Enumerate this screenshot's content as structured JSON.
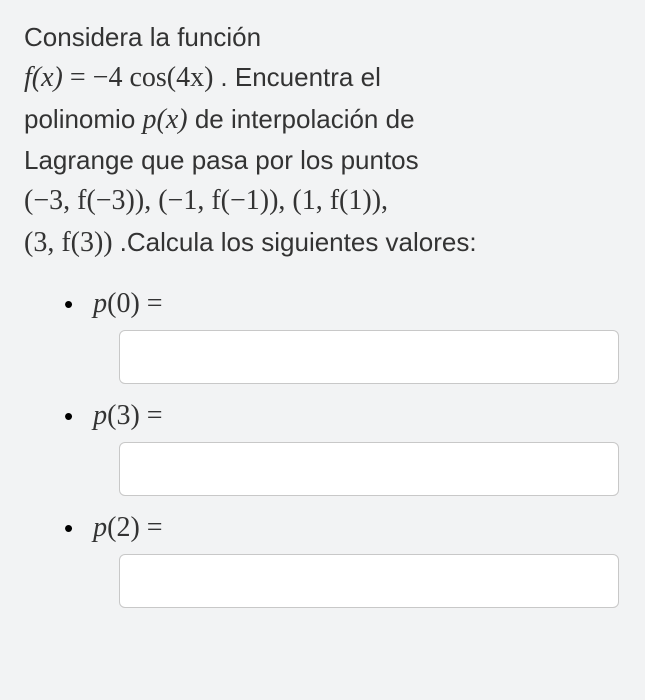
{
  "problem": {
    "intro": "Considera la función",
    "func_def_lhs": "f(x)",
    "func_def_eq": "=",
    "func_def_rhs": "−4 cos(4x)",
    "after_func": ". Encuentra el",
    "line2_pre": "polinomio ",
    "poly": "p(x)",
    "line2_post": " de interpolación de",
    "line3": "Lagrange que pasa por los puntos",
    "points1": "(−3, f(−3)), (−1, f(−1)), (1, f(1)),",
    "points2": "(3, f(3))",
    "after_points": ".Calcula los siguientes valores:"
  },
  "questions": [
    {
      "label_var": "p",
      "label_arg": "0",
      "label_eq": "="
    },
    {
      "label_var": "p",
      "label_arg": "3",
      "label_eq": "="
    },
    {
      "label_var": "p",
      "label_arg": "2",
      "label_eq": "="
    }
  ]
}
